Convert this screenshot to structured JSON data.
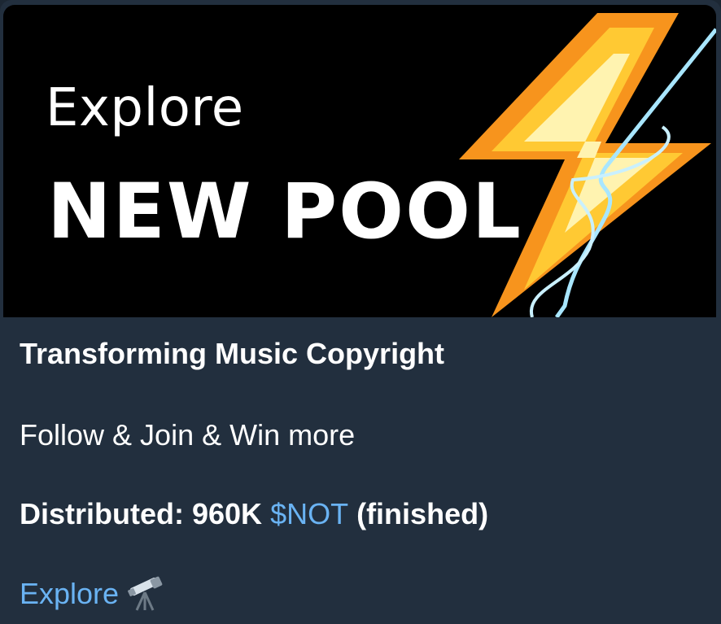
{
  "banner": {
    "explore_text": "Explore",
    "headline": "NEW POOL"
  },
  "post": {
    "title": "Transforming Music Copyright",
    "subtitle": "Follow & Join & Win more",
    "distributed_label": "Distributed: 960K ",
    "token": "$NOT",
    "status": " (finished)",
    "link_label": "Explore",
    "link_icon": "telescope-icon"
  },
  "colors": {
    "background": "#222f3e",
    "link": "#6ab3f3",
    "bolt_outer": "#f7941d",
    "bolt_inner": "#ffd34d",
    "bolt_core": "#fff3b0",
    "lightning_wire": "#a8e6ff"
  }
}
